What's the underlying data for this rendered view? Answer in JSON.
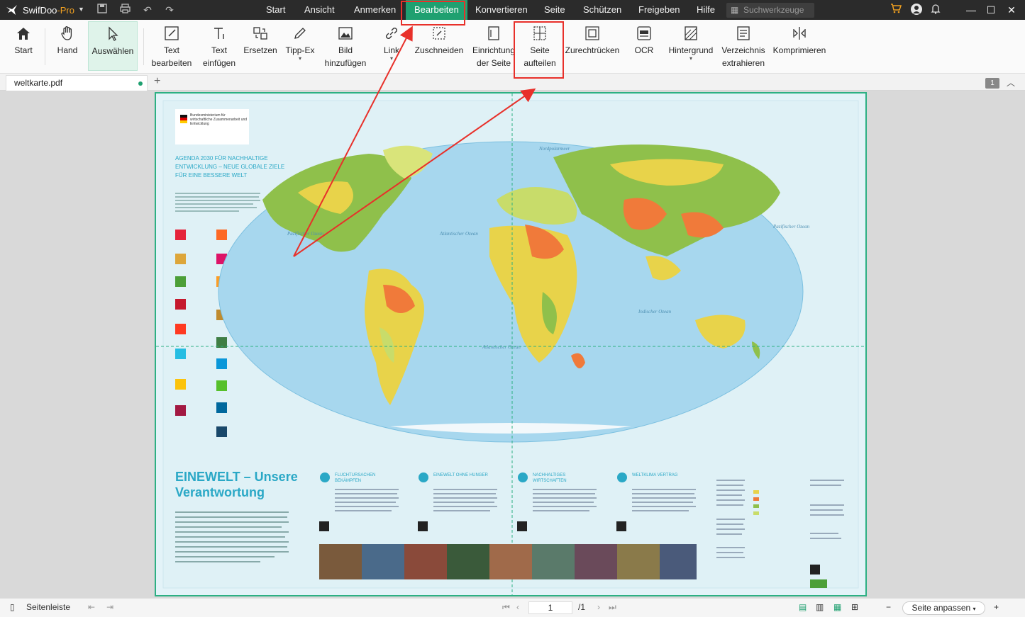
{
  "app": {
    "name": "SwifDoo",
    "name_suffix": "-Pro"
  },
  "menu": {
    "items": [
      "Start",
      "Ansicht",
      "Anmerken",
      "Bearbeiten",
      "Konvertieren",
      "Seite",
      "Schützen",
      "Freigeben",
      "Hilfe"
    ],
    "active": "Bearbeiten"
  },
  "search": {
    "placeholder": "Suchwerkzeuge"
  },
  "ribbon": {
    "start": "Start",
    "hand": "Hand",
    "select": "Auswählen",
    "edit_text": "Text\nbearbeiten",
    "insert_text": "Text\neinfügen",
    "replace": "Ersetzen",
    "whiteout": "Tipp-Ex",
    "add_image": "Bild\nhinzufügen",
    "link": "Link",
    "crop": "Zuschneiden",
    "page_setup": "Einrichtung\nder Seite",
    "split_page": "Seite\naufteilen",
    "deskew": "Zurechtrücken",
    "ocr": "OCR",
    "background": "Hintergrund",
    "extract_toc": "Verzeichnis\nextrahieren",
    "compress": "Komprimieren"
  },
  "tabs": {
    "file": "weltkarte.pdf",
    "page_badge": "1"
  },
  "document": {
    "ministry": "Bundesministerium für wirtschaftliche Zusammenarbeit und Entwicklung",
    "agenda_title": "AGENDA 2030 FÜR NACHHALTIGE ENTWICKLUNG – NEUE GLOBALE ZIELE FÜR EINE BESSERE WELT",
    "headline": "EINEWELT – Unsere Verantwortung",
    "sections": [
      "FLUCHTURSACHEN BEKÄMPFEN",
      "EINEWELT OHNE HUNGER",
      "NACHHALTIGES WIRTSCHAFTEN",
      "WELTKLIMA VERTRAG"
    ],
    "ocean_labels": [
      "Pazifischer Ozean",
      "Atlantischer Ozean",
      "Indischer Ozean",
      "Pazifischer Ozean",
      "Atlantischer Ozean",
      "Nordpolarmeer"
    ]
  },
  "status": {
    "sidebar": "Seitenleiste",
    "current_page": "1",
    "total_pages": "/1",
    "zoom_mode": "Seite anpassen"
  },
  "colors": {
    "accent": "#1fa070",
    "highlight": "#e8302a",
    "page_border": "#2db083"
  }
}
